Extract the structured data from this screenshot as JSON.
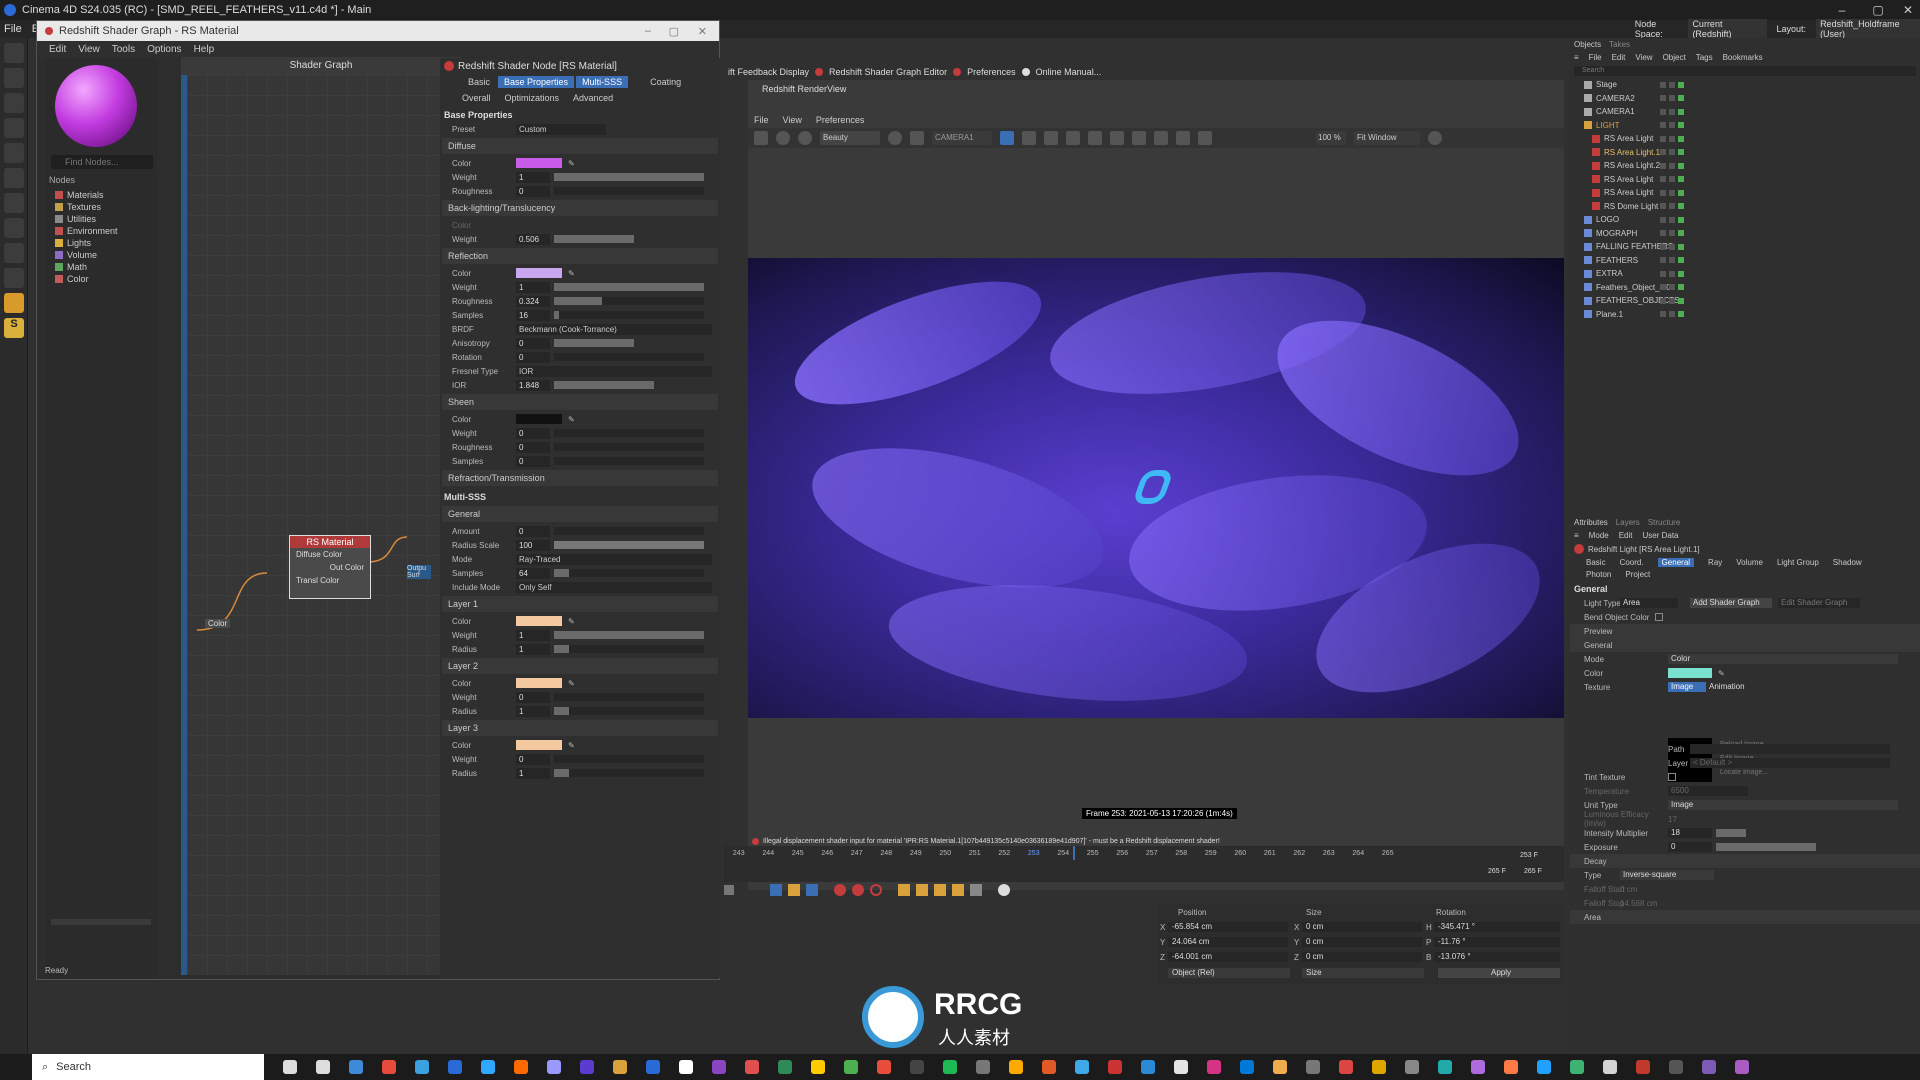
{
  "titlebar": {
    "text": "Cinema 4D S24.035 (RC) - [SMD_REEL_FEATHERS_v11.c4d *] - Main"
  },
  "main_menu": [
    "File",
    "Edit"
  ],
  "node_space": {
    "label": "Node Space:",
    "value": "Current (Redshift)"
  },
  "layout": {
    "label": "Layout:",
    "value": "Redshift_Holdframe (User)"
  },
  "shader_graph": {
    "title": "Redshift Shader Graph - RS Material",
    "menu": [
      "Edit",
      "View",
      "Tools",
      "Options",
      "Help"
    ],
    "find_placeholder": "Find Nodes...",
    "nodes_title": "Nodes",
    "categories": [
      {
        "label": "Materials",
        "color": "#c24d4d"
      },
      {
        "label": "Textures",
        "color": "#c4a04c"
      },
      {
        "label": "Utilities",
        "color": "#8a8a8a"
      },
      {
        "label": "Environment",
        "color": "#c0504d"
      },
      {
        "label": "Lights",
        "color": "#d9b03c"
      },
      {
        "label": "Volume",
        "color": "#8c6bc4"
      },
      {
        "label": "Math",
        "color": "#5ea55e"
      },
      {
        "label": "Color",
        "color": "#c55b5b"
      }
    ],
    "graph_title": "Shader Graph",
    "node": {
      "title": "RS Material",
      "ports": [
        "Diffuse Color",
        "Out Color",
        "Transl Color"
      ]
    },
    "in_node": "Color",
    "out_node": "Outpu Surf",
    "status": "Ready"
  },
  "props": {
    "header": "Redshift Shader Node [RS Material]",
    "tabs_row1": [
      "Basic",
      "Base Properties",
      "Multi-SSS",
      "Coating"
    ],
    "tabs_row2": [
      "Overall",
      "Optimizations",
      "Advanced"
    ],
    "base_properties": "Base Properties",
    "preset": {
      "label": "Preset",
      "value": "Custom"
    },
    "diffuse": {
      "title": "Diffuse",
      "color": "#c95ce8",
      "weight": "1",
      "roughness": "0"
    },
    "backlighting": {
      "title": "Back-lighting/Translucency",
      "color_label": "Color",
      "weight": "0.506"
    },
    "reflection": {
      "title": "Reflection",
      "color": "#c9a7f0",
      "weight": "1",
      "roughness": "0.324",
      "samples": "16",
      "brdf": "Beckmann (Cook-Torrance)",
      "anisotropy": "0",
      "rotation": "0",
      "fresnel_type": "IOR",
      "ior": "1.848"
    },
    "sheen": {
      "title": "Sheen",
      "color": "#111111",
      "weight": "0",
      "roughness": "0",
      "samples": "0"
    },
    "refraction": "Refraction/Transmission",
    "multisss": "Multi-SSS",
    "general": {
      "title": "General",
      "amount": "0",
      "radius_scale": "100",
      "mode": "Ray-Traced",
      "samples": "64",
      "include_mode": "Only Self"
    },
    "layer1": {
      "title": "Layer 1",
      "color": "#f5c9a0",
      "weight": "1",
      "radius": "1"
    },
    "layer2": {
      "title": "Layer 2",
      "color": "#f5c9a0",
      "weight": "0",
      "radius": "1"
    },
    "layer3": {
      "title": "Layer 3",
      "color": "#f5c9a0",
      "weight": "0",
      "radius": "1"
    },
    "labels": {
      "color": "Color",
      "weight": "Weight",
      "roughness": "Roughness",
      "samples": "Samples",
      "brdf": "BRDF",
      "anisotropy": "Anisotropy",
      "rotation": "Rotation",
      "fresnel": "Fresnel Type",
      "ior": "IOR",
      "amount": "Amount",
      "radius_scale": "Radius Scale",
      "mode": "Mode",
      "include": "Include Mode",
      "radius": "Radius"
    }
  },
  "topbar_buttons": [
    "ift Feedback Display",
    "Redshift Shader Graph Editor",
    "Preferences",
    "Online Manual..."
  ],
  "renderview": {
    "title": "Redshift RenderView",
    "menu": [
      "File",
      "View",
      "Preferences"
    ],
    "aov": "Beauty",
    "camera": "CAMERA1",
    "zoom": "100 %",
    "fit": "Fit Window",
    "frame_label": "Frame 253: 2021-05-13 17:20:26 (1m:4s)",
    "error": "Illegal displacement shader input for material 'IPR:RS Material.1[107b4491​35c5140e03636189e41d907]' - must be a Redshift displacement shader!"
  },
  "timeline": {
    "ticks": [
      "243",
      "244",
      "245",
      "246",
      "247",
      "248",
      "249",
      "250",
      "251",
      "252",
      "253",
      "254",
      "255",
      "256",
      "257",
      "258",
      "259",
      "260",
      "261",
      "262",
      "263",
      "264",
      "265"
    ],
    "current": "253",
    "current_frame": "253 F",
    "end1": "265 F",
    "end2": "265 F"
  },
  "coords": {
    "headers": [
      "Position",
      "Size",
      "Rotation"
    ],
    "x": {
      "label": "X",
      "pos": "-65.854 cm",
      "size": "0 cm",
      "rot_label": "H",
      "rot": "-345.471 °"
    },
    "y": {
      "label": "Y",
      "pos": "24.064 cm",
      "size": "0 cm",
      "rot_label": "P",
      "rot": "-11.76 °"
    },
    "z": {
      "label": "Z",
      "pos": "-64.001 cm",
      "size": "0 cm",
      "rot_label": "B",
      "rot": "-13.076 °"
    },
    "mode1": "Object (Rel)",
    "mode2": "Size",
    "apply": "Apply"
  },
  "objects": {
    "tabs": [
      "Objects",
      "Takes"
    ],
    "menu": [
      "File",
      "Edit",
      "View",
      "Object",
      "Tags",
      "Bookmarks"
    ],
    "search": "Search",
    "items": [
      {
        "label": "Stage",
        "color": "#aaaaaa",
        "indent": 0
      },
      {
        "label": "CAMERA2",
        "color": "#aaaaaa",
        "indent": 0
      },
      {
        "label": "CAMERA1",
        "color": "#aaaaaa",
        "indent": 0
      },
      {
        "label": "LIGHT",
        "color": "#d9a13c",
        "indent": 0,
        "accent": "#d9a13c"
      },
      {
        "label": "RS Area Light",
        "color": "#c43c3c",
        "indent": 1
      },
      {
        "label": "RS Area Light.1",
        "color": "#c43c3c",
        "indent": 1,
        "accent": "#e8c06a"
      },
      {
        "label": "RS Area Light.2",
        "color": "#c43c3c",
        "indent": 1
      },
      {
        "label": "RS Area Light",
        "color": "#c43c3c",
        "indent": 1
      },
      {
        "label": "RS Area Light",
        "color": "#c43c3c",
        "indent": 1
      },
      {
        "label": "RS Dome Light",
        "color": "#c43c3c",
        "indent": 1
      },
      {
        "label": "LOGO",
        "color": "#6a8ad6",
        "indent": 0
      },
      {
        "label": "MOGRAPH",
        "color": "#6a8ad6",
        "indent": 0
      },
      {
        "label": "FALLING FEATHERS",
        "color": "#6a8ad6",
        "indent": 0
      },
      {
        "label": "FEATHERS",
        "color": "#6a8ad6",
        "indent": 0
      },
      {
        "label": "EXTRA",
        "color": "#6a8ad6",
        "indent": 0
      },
      {
        "label": "Feathers_Object_4.0",
        "color": "#6a8ad6",
        "indent": 0
      },
      {
        "label": "FEATHERS_OBJECTS",
        "color": "#6a8ad6",
        "indent": 0
      },
      {
        "label": "Plane.1",
        "color": "#6a8ad6",
        "indent": 0
      }
    ]
  },
  "attributes": {
    "tabs": [
      "Attributes",
      "Layers",
      "Structure"
    ],
    "menu": [
      "Mode",
      "Edit",
      "User Data"
    ],
    "object": "Redshift Light [RS Area Light.1]",
    "tabs_row1": [
      "Basic",
      "Coord.",
      "General",
      "Ray",
      "Volume",
      "Light Group",
      "Shadow"
    ],
    "tabs_row2": [
      "Photon",
      "Project"
    ],
    "section": "General",
    "light_type": {
      "label": "Light Type",
      "value": "Area"
    },
    "add_shader": "Add Shader Graph",
    "edit_shader": "Edit Shader Graph",
    "blend": "Bend Object Color",
    "preview": "Preview",
    "general": "General",
    "mode": {
      "label": "Mode",
      "value": "Color"
    },
    "color": {
      "label": "Color",
      "value": "#7be1cf"
    },
    "texture": {
      "label": "Texture",
      "tab1": "Image",
      "tab2": "Animation"
    },
    "tex_buttons": [
      "Reload Image...",
      "Edit Image...",
      "Locate Image..."
    ],
    "path": "Path",
    "layer": {
      "label": "Layer",
      "value": "< Default >"
    },
    "tint": "Tint Texture",
    "temperature": {
      "label": "Temperature",
      "value": "6500"
    },
    "unit": {
      "label": "Unit Type",
      "value": "Image"
    },
    "luminous": {
      "label": "Luminous Efficacy (lm/w)",
      "value": "17"
    },
    "intensity": {
      "label": "Intensity Multiplier",
      "value": "18"
    },
    "exposure": {
      "label": "Exposure",
      "value": "0"
    },
    "decay": "Decay",
    "decay_type": {
      "label": "Type",
      "value": "Inverse-square"
    },
    "falloff_start": {
      "label": "Falloff Start",
      "value": "0 cm"
    },
    "falloff_stop": {
      "label": "Falloff Stop",
      "value": "14.568 cm"
    },
    "area": "Area"
  },
  "taskbar": {
    "search": "Search",
    "icon_colors": [
      "#ddd",
      "#ddd",
      "#3f8ad8",
      "#e64b3c",
      "#3aa0e0",
      "#2a6ad6",
      "#31a8ff",
      "#ff6a00",
      "#9999ff",
      "#5b3bd0",
      "#d9a13c",
      "#2a6ad6",
      "#fff",
      "#8a45c0",
      "#e05050",
      "#2e8b57",
      "#ffcc00",
      "#4caf50",
      "#e84d3c",
      "#444",
      "#1db954",
      "#777",
      "#ffaa00",
      "#e05a28",
      "#3ea8e8",
      "#cc3333",
      "#2a8ad6",
      "#e5e5e5",
      "#d63384",
      "#0078d7",
      "#f0ad4e",
      "#777",
      "#dd4444",
      "#e0a600",
      "#888",
      "#2aa",
      "#b06ae0",
      "#ff7a45",
      "#20a0ff",
      "#3cb371",
      "#d4d4d4",
      "#c0392b",
      "#555",
      "#7d5ab5",
      "#aa5cc3"
    ]
  },
  "watermark": {
    "text1": "RRCG",
    "text2": "人人素材"
  }
}
